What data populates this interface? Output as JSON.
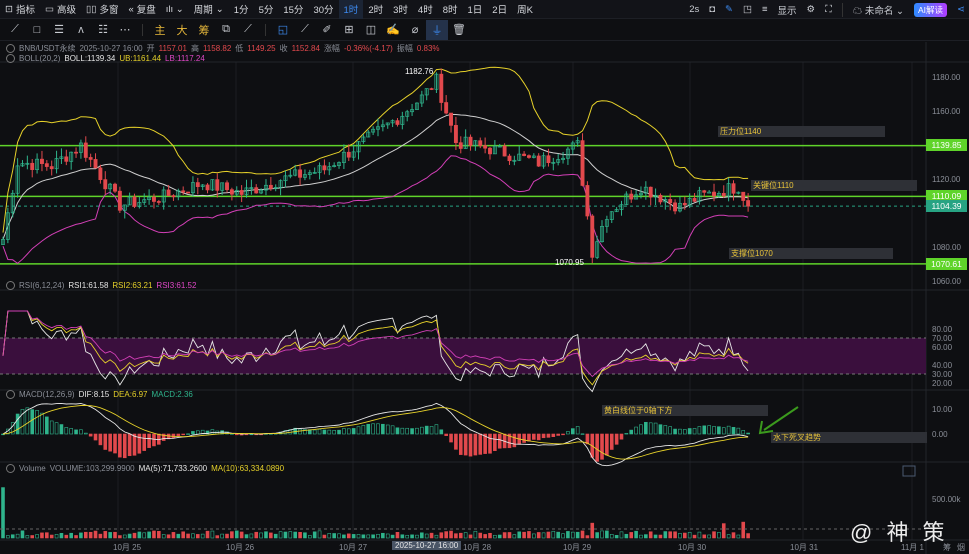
{
  "toolbar": {
    "items": [
      {
        "label": "指标",
        "icon": "indicator-icon"
      },
      {
        "label": "高级",
        "icon": "advanced-icon"
      },
      {
        "label": "多窗",
        "icon": "multi-window-icon"
      },
      {
        "label": "复盘",
        "icon": "replay-icon"
      },
      {
        "label": "",
        "icon": "chart-type-icon"
      },
      {
        "label": "周期",
        "icon": ""
      }
    ],
    "periods": [
      "1分",
      "5分",
      "15分",
      "30分",
      "1时",
      "2时",
      "3时",
      "4时",
      "8时",
      "1日",
      "2日",
      "周K"
    ],
    "active_period": "1时",
    "right": {
      "refresh": "2s",
      "display": "显示",
      "layout_name": "未命名",
      "ai_button": "AI解读"
    },
    "draw_tools_text": [
      "主",
      "大",
      "筹"
    ]
  },
  "legend": {
    "symbol": "BNB/USDT永续",
    "datetime": "2025-10-27 16:00",
    "open_label": "开",
    "open": "1157.01",
    "high_label": "高",
    "high": "1158.82",
    "low_label": "低",
    "low": "1149.25",
    "close_label": "收",
    "close": "1152.84",
    "change_label": "涨幅",
    "change": "-0.36%(-4.17)",
    "amp_label": "振幅",
    "amp": "0.83%",
    "boll": {
      "name": "BOLL(20,2)",
      "mid": "BOLL:1139.34",
      "ub": "UB:1161.44",
      "lb": "LB:1117.24"
    },
    "rsi": {
      "name": "RSI(6,12,24)",
      "r1": "RSI1:61.58",
      "r2": "RSI2:63.21",
      "r3": "RSI3:61.52"
    },
    "macd": {
      "name": "MACD(12,26,9)",
      "dif": "DIF:8.15",
      "dea": "DEA:6.97",
      "macd": "MACD:2.36"
    },
    "volume": {
      "name": "Volume",
      "vol": "VOLUME:103,299.9900",
      "ma5": "MA(5):71,733.2600",
      "ma10": "MA(10):63,334.0890"
    }
  },
  "annotations": {
    "resistance": "压力位1140",
    "key": "关键位1110",
    "support": "支撑位1070",
    "macd_note": "黄白线位于0轴下方",
    "macd_note2": "水下死叉趋势",
    "high_mark": "1182.76",
    "low_mark": "1070.95"
  },
  "price_axis": [
    "1180.00",
    "1160.00",
    "1120.00",
    "1080.00",
    "1060.00"
  ],
  "price_tags": {
    "resistance": "1139.85",
    "key": "1110.09",
    "last": "1104.39",
    "support": "1070.61"
  },
  "rsi_axis": [
    "80.00",
    "70.00",
    "60.00",
    "40.00",
    "30.00",
    "20.00"
  ],
  "macd_axis": [
    "10.00",
    "0.00"
  ],
  "vol_axis": [
    "500.00k"
  ],
  "time_axis": [
    "10月 25",
    "10月 26",
    "10月 27",
    "10月 28",
    "10月 29",
    "10月 30",
    "10月 31",
    "11月 1"
  ],
  "crosshair_time": "2025-10-27 16:00",
  "bottom_right": [
    "筹",
    "烟"
  ],
  "watermark": "@ 神 策",
  "colors": {
    "up": "#2fb48c",
    "down": "#e2494d",
    "boll_mid": "#cfcfcf",
    "boll_ub": "#e6d12a",
    "boll_lb": "#d23fb6",
    "level": "#5fd42a"
  },
  "chart_data": {
    "type": "candlestick",
    "symbol": "BNB/USDT",
    "interval": "1h",
    "close_keypoints": [
      [
        0,
        1085
      ],
      [
        3,
        1130
      ],
      [
        10,
        1128
      ],
      [
        16,
        1140
      ],
      [
        24,
        1105
      ],
      [
        33,
        1110
      ],
      [
        41,
        1118
      ],
      [
        49,
        1112
      ],
      [
        57,
        1120
      ],
      [
        66,
        1126
      ],
      [
        73,
        1140
      ],
      [
        81,
        1156
      ],
      [
        86,
        1168
      ],
      [
        89,
        1178
      ],
      [
        93,
        1142
      ],
      [
        100,
        1138
      ],
      [
        110,
        1130
      ],
      [
        118,
        1140
      ],
      [
        121,
        1078
      ],
      [
        124,
        1100
      ],
      [
        131,
        1116
      ],
      [
        139,
        1104
      ],
      [
        143,
        1110
      ],
      [
        151,
        1116
      ],
      [
        153,
        1104.39
      ]
    ],
    "high": 1182.76,
    "low": 1070.95,
    "levels": [
      1139.85,
      1110.09,
      1070.61
    ],
    "ylim": [
      1055,
      1190
    ]
  }
}
